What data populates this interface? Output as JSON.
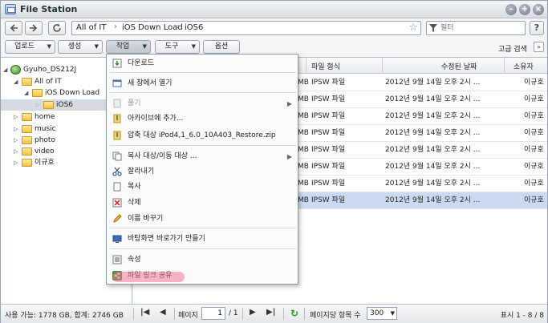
{
  "app": {
    "title": "File Station"
  },
  "nav": {
    "path": [
      "All of IT",
      "iOS Down Load",
      "iOS6"
    ],
    "filter_placeholder": "필터",
    "help_label": "?"
  },
  "toolbar": {
    "buttons": [
      "업로드",
      "생성",
      "작업",
      "도구",
      "옵션"
    ],
    "advanced_search": "고급 검색"
  },
  "tree": {
    "items": [
      {
        "label": "Gyuho_DS212J"
      },
      {
        "label": "All of IT"
      },
      {
        "label": "iOS Down Load"
      },
      {
        "label": "iOS6"
      },
      {
        "label": "home"
      },
      {
        "label": "music"
      },
      {
        "label": "photo"
      },
      {
        "label": "video"
      },
      {
        "label": "이규호"
      }
    ]
  },
  "grid": {
    "headers": [
      "파일 형식",
      "수정된 날짜",
      "소유자"
    ],
    "rows": [
      {
        "size": "MB",
        "type": "IPSW 파일",
        "date": "2012년 9월 14일 오후 2시 ...",
        "owner": "이규호"
      },
      {
        "size": "MB",
        "type": "IPSW 파일",
        "date": "2012년 9월 14일 오후 2시 ...",
        "owner": "이규호"
      },
      {
        "size": "MB",
        "type": "IPSW 파일",
        "date": "2012년 9월 14일 오후 2시 ...",
        "owner": "이규호"
      },
      {
        "size": "MB",
        "type": "IPSW 파일",
        "date": "2012년 9월 14일 오후 2시 ...",
        "owner": "이규호"
      },
      {
        "size": "MB",
        "type": "IPSW 파일",
        "date": "2012년 9월 14일 오후 2시 ...",
        "owner": "이규호"
      },
      {
        "size": "MB",
        "type": "IPSW 파일",
        "date": "2012년 9월 14일 오후 2시 ...",
        "owner": "이규호"
      },
      {
        "size": "MB",
        "type": "IPSW 파일",
        "date": "2012년 9월 14일 오후 2시 ...",
        "owner": "이규호"
      },
      {
        "size": "MB",
        "type": "IPSW 파일",
        "date": "2012년 9월 14일 오후 2시 ...",
        "owner": "이규호"
      }
    ]
  },
  "menu": {
    "items": [
      {
        "label": "다운로드",
        "icon": "download-icon"
      },
      {
        "label": "새 창에서 열기",
        "icon": "new-window-icon"
      },
      {
        "label": "풀기",
        "icon": "extract-icon",
        "disabled": true,
        "submenu": true
      },
      {
        "label": "아카이브에 추가...",
        "icon": "archive-add-icon"
      },
      {
        "label": "압축 대상 iPod4,1_6.0_10A403_Restore.zip",
        "icon": "compress-icon"
      },
      {
        "label": "복사 대상/이동 대상 ...",
        "icon": "copy-move-icon",
        "submenu": true
      },
      {
        "label": "잘라내기",
        "icon": "scissors-icon"
      },
      {
        "label": "복사",
        "icon": "copy-icon"
      },
      {
        "label": "삭제",
        "icon": "delete-icon"
      },
      {
        "label": "이름 바꾸기",
        "icon": "rename-icon"
      },
      {
        "label": "바탕화면 바로가기 만들기",
        "icon": "desktop-shortcut-icon"
      },
      {
        "label": "속성",
        "icon": "properties-icon"
      },
      {
        "label": "파일 링크 공유",
        "icon": "share-link-icon"
      }
    ]
  },
  "status": {
    "storage": "사용 가능: 1778 GB, 합계: 2746 GB",
    "page_label": "페이지",
    "page_value": "1",
    "page_total": "/ 1",
    "per_page_label": "페이지당 항목 수",
    "per_page_value": "300",
    "display_range": "표시 1 - 8 / 8"
  },
  "colors": {
    "selection": "#c9daf1",
    "highlight": "#f07896"
  }
}
